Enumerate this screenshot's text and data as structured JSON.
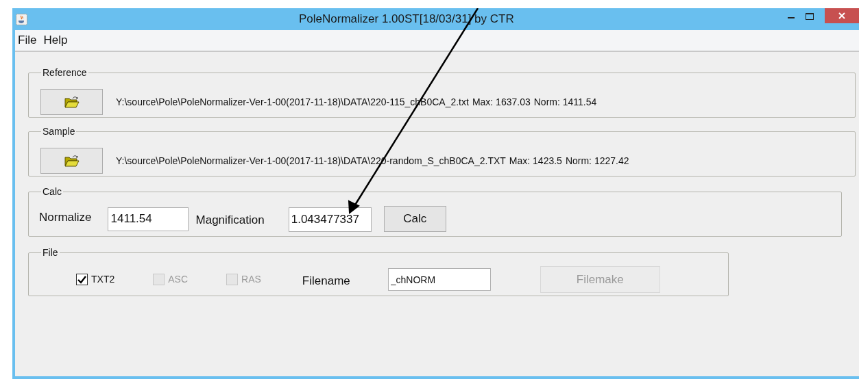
{
  "window": {
    "title": "PoleNormalizer 1.00ST[18/03/31] by CTR"
  },
  "menu": [
    "File",
    "Help"
  ],
  "inputs": [
    {
      "title": "Reference",
      "path": "Y:\\source\\Pole\\PoleNormalizer-Ver-1-00(2017-11-18)\\DATA\\220-115_chB0CA_2.txt",
      "max": "Max: 1637.03",
      "norm": "Norm: 1411.54"
    },
    {
      "title": "Sample",
      "path": "Y:\\source\\Pole\\PoleNormalizer-Ver-1-00(2017-11-18)\\DATA\\220-random_S_chB0CA_2.TXT",
      "max": "Max: 1423.5",
      "norm": "Norm: 1227.42"
    }
  ],
  "calc": {
    "title": "Calc",
    "normalize_label": "Normalize",
    "normalize_value": "1411.54",
    "magnification_label": "Magnification",
    "magnification_value": "1.043477337",
    "button": "Calc"
  },
  "file": {
    "title": "File",
    "options": [
      {
        "label": "TXT2",
        "checked": true,
        "disabled": false
      },
      {
        "label": "ASC",
        "checked": false,
        "disabled": true
      },
      {
        "label": "RAS",
        "checked": false,
        "disabled": true
      }
    ],
    "filename_label": "Filename",
    "filename_value": "_chNORM",
    "button": {
      "label": "Filemake",
      "disabled": true
    }
  }
}
